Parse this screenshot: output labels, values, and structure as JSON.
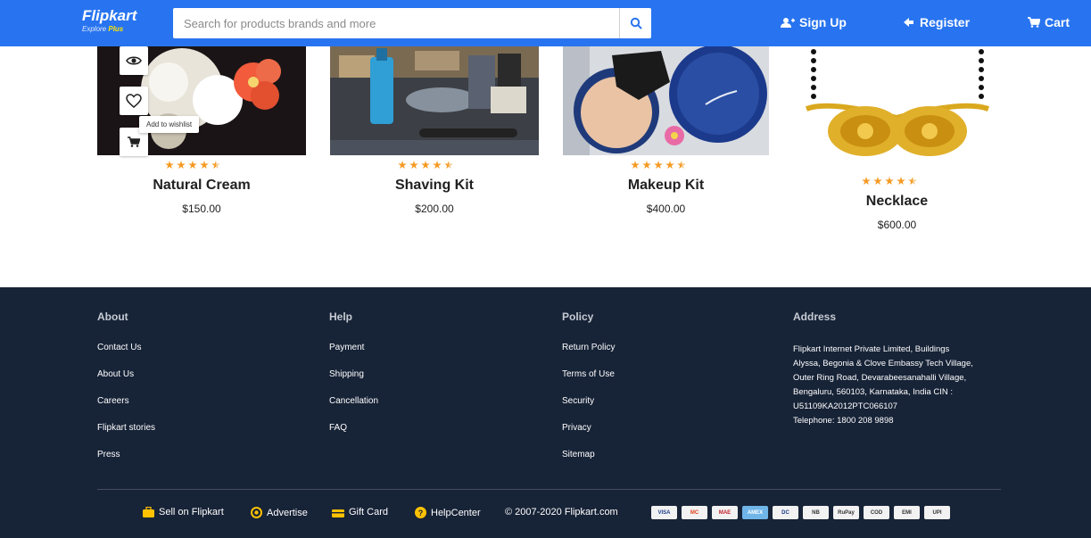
{
  "header": {
    "logo_name": "Flipkart",
    "logo_tagline": "Explore",
    "logo_plus": "Plus",
    "search_placeholder": "Search for products brands and more",
    "signup_label": "Sign Up",
    "register_label": "Register",
    "cart_label": "Cart"
  },
  "colors": {
    "header_bg": "#2874f0",
    "footer_bg": "#172337",
    "star": "#f59a23",
    "accent_yellow": "#ffc200"
  },
  "products": [
    {
      "name": "Natural Cream",
      "price": "$150.00",
      "rating": 4.5
    },
    {
      "name": "Shaving Kit",
      "price": "$200.00",
      "rating": 4.5
    },
    {
      "name": "Makeup Kit",
      "price": "$400.00",
      "rating": 4.5
    },
    {
      "name": "Necklace",
      "price": "$600.00",
      "rating": 4.5
    }
  ],
  "product_actions": {
    "tooltip": "Add to wishlist",
    "icons": [
      "eye-icon",
      "heart-icon",
      "cart-icon"
    ]
  },
  "footer": {
    "about": {
      "title": "About",
      "links": [
        "Contact Us",
        "About Us",
        "Careers",
        "Flipkart stories",
        "Press"
      ]
    },
    "help": {
      "title": "Help",
      "links": [
        "Payment",
        "Shipping",
        "Cancellation",
        "FAQ"
      ]
    },
    "policy": {
      "title": "Policy",
      "links": [
        "Return Policy",
        "Terms of Use",
        "Security",
        "Privacy",
        "Sitemap"
      ]
    },
    "address": {
      "title": "Address",
      "lines": [
        "Flipkart Internet Private Limited, Buildings",
        "Alyssa, Begonia & Clove Embassy Tech Village,",
        "Outer Ring Road, Devarabeesanahalli Village,",
        "Bengaluru, 560103, Karnataka, India CIN :",
        "U51109KA2012PTC066107",
        "Telephone: 1800 208 9898"
      ]
    },
    "bottom": {
      "sell": "Sell on Flipkart",
      "advertise": "Advertise",
      "gift": "Gift Card",
      "help_center": "HelpCenter",
      "copyright": "© 2007-2020 Flipkart.com"
    },
    "payments": [
      "VISA",
      "MC",
      "MAE",
      "AMEX",
      "DC",
      "NB",
      "RuPay",
      "COD",
      "EMI",
      "UPI"
    ]
  }
}
